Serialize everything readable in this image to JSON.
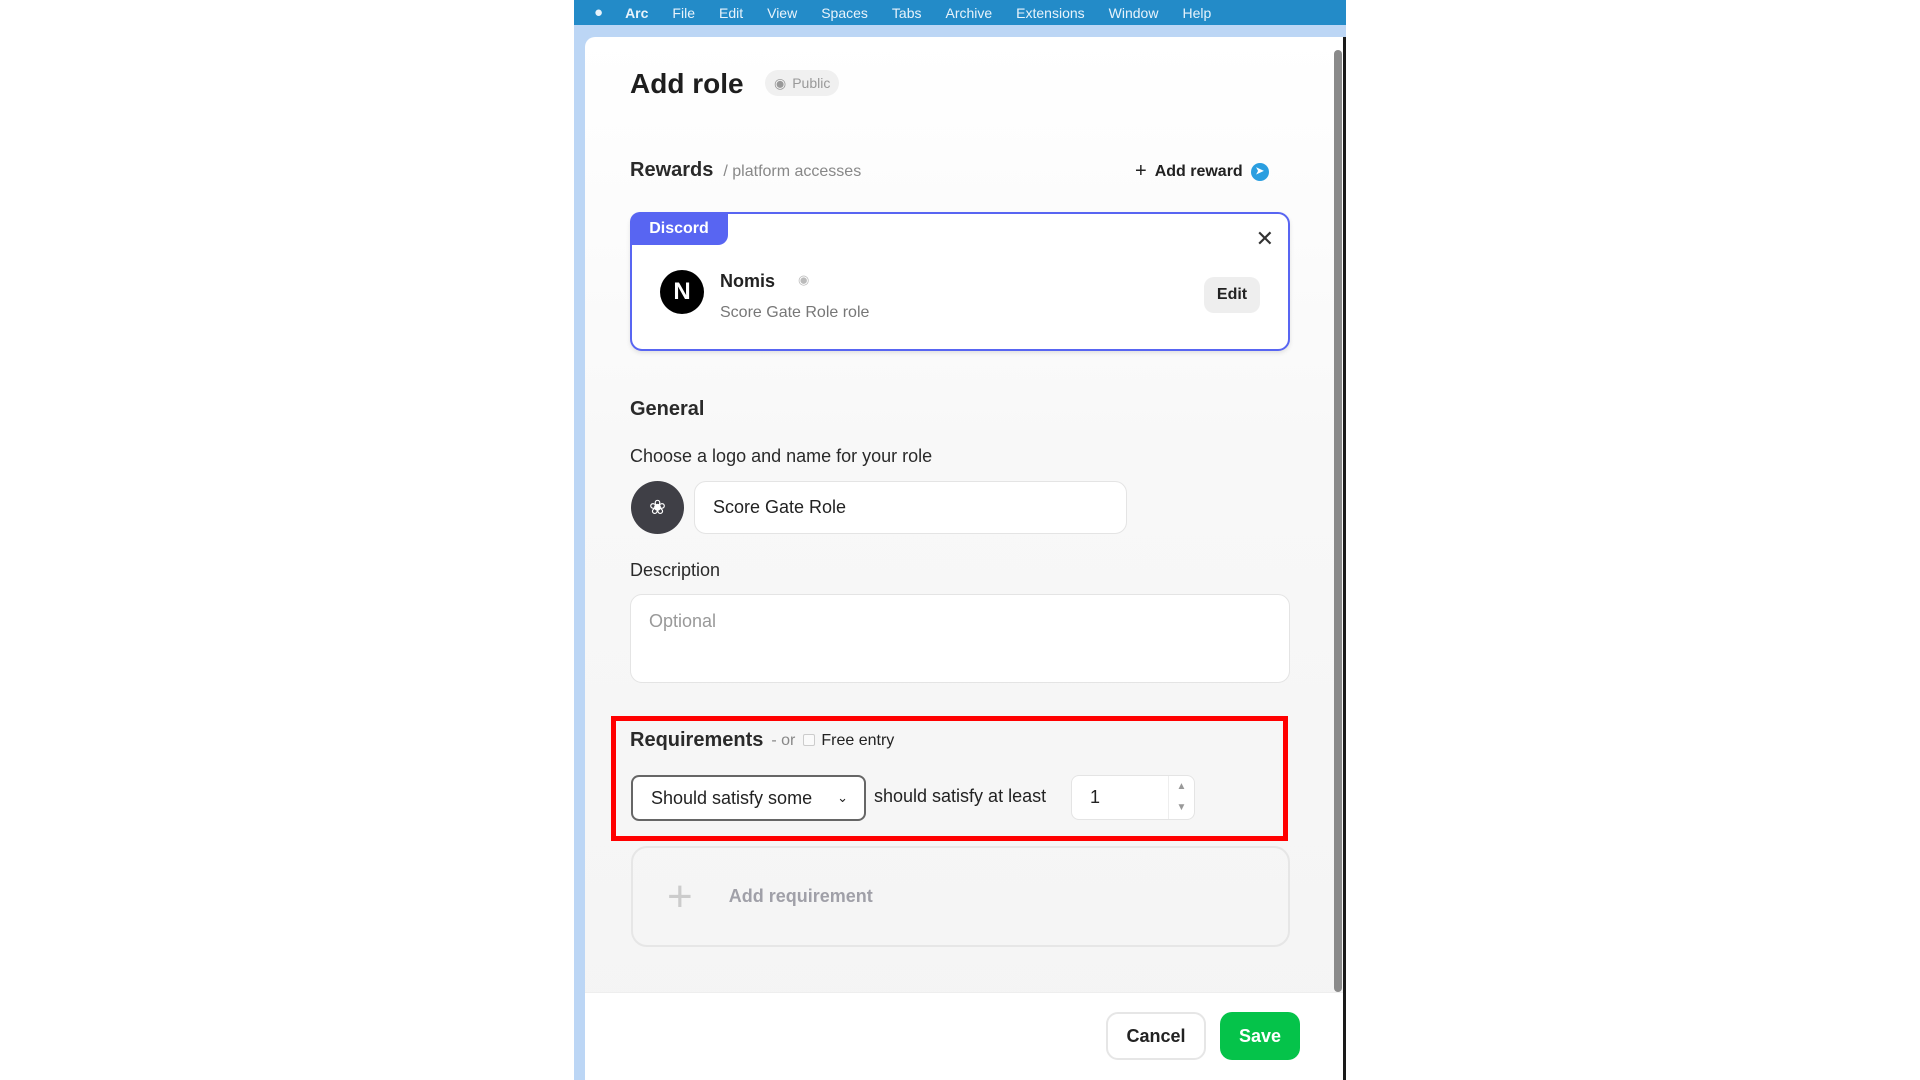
{
  "menubar": {
    "app": "Arc",
    "items": [
      "File",
      "Edit",
      "View",
      "Spaces",
      "Tabs",
      "Archive",
      "Extensions",
      "Window",
      "Help"
    ]
  },
  "header": {
    "title": "Add role",
    "visibility": "Public"
  },
  "rewards": {
    "title": "Rewards",
    "subtitle": "/ platform accesses",
    "add_label": "Add reward",
    "card": {
      "platform": "Discord",
      "name": "Nomis",
      "avatar_letter": "N",
      "role": "Score Gate Role role",
      "edit_label": "Edit"
    }
  },
  "general": {
    "title": "General",
    "logo_label": "Choose a logo and name for your role",
    "name_value": "Score Gate Role",
    "description_label": "Description",
    "description_placeholder": "Optional"
  },
  "requirements": {
    "title": "Requirements",
    "or": "- or",
    "free_entry": "Free entry",
    "logic_value": "Should satisfy some",
    "at_least_label": "should satisfy at least",
    "at_least_value": "1",
    "add_label": "Add requirement"
  },
  "footer": {
    "cancel": "Cancel",
    "save": "Save"
  },
  "colors": {
    "discord": "#5865f2",
    "save": "#05c34a",
    "highlight": "#ff0000",
    "menubar": "#238bc8"
  }
}
